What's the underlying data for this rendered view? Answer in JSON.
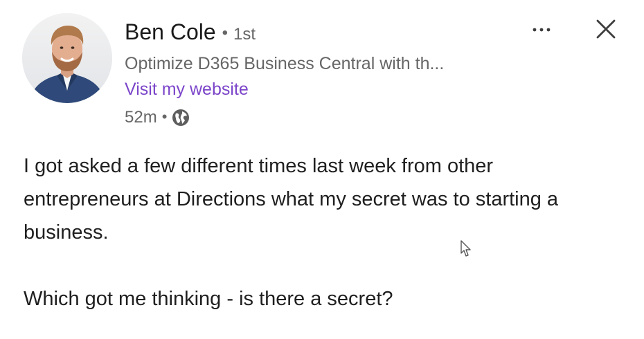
{
  "author": {
    "name": "Ben Cole",
    "degree": "1st",
    "headline": "Optimize D365 Business Central with th...",
    "website_label": "Visit my website"
  },
  "meta": {
    "time_ago": "52m",
    "separator": "•",
    "visibility_icon": "globe-icon"
  },
  "controls": {
    "more_icon": "more-horizontal-icon",
    "close_icon": "close-icon"
  },
  "post": {
    "paragraphs": [
      "I got asked a few different times last week from other entrepreneurs at Directions what my secret was to starting a business.",
      "Which got me thinking - is there a secret?"
    ]
  },
  "colors": {
    "link": "#7b45c9",
    "secondary_text": "#666666",
    "primary_text": "#1f1f1f"
  }
}
